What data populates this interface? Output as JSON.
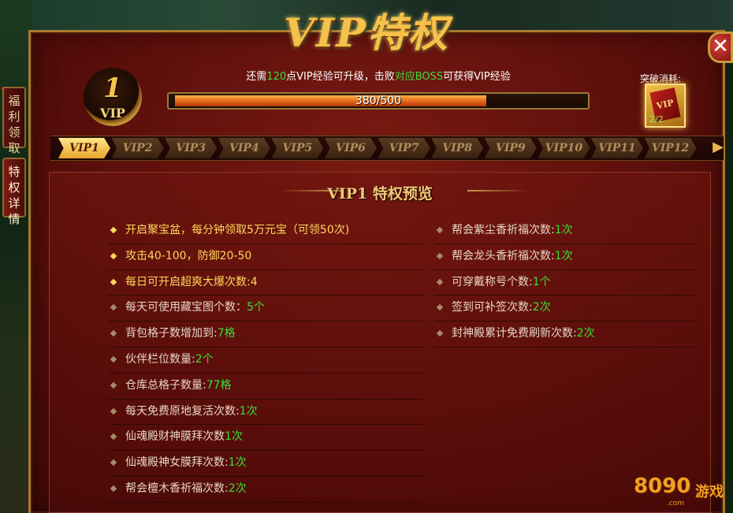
{
  "window": {
    "title": "VIP特权",
    "close_label": "✕"
  },
  "side_tabs": [
    {
      "label": "福利领取"
    },
    {
      "label": "特权详情"
    }
  ],
  "vip_badge": {
    "level": "1",
    "label": "VIP"
  },
  "notice": {
    "part1": "还需",
    "points": "120",
    "part2": "点VIP经验可升级，击败",
    "boss": "对应BOSS",
    "part3": "可获得VIP经验"
  },
  "progress": {
    "current": 380,
    "max": 500,
    "text": "380/500",
    "fraction": 0.76
  },
  "breakthrough": {
    "label": "突破消耗:",
    "item_text": "VIP",
    "count": "2/2"
  },
  "vip_tabs": [
    "VIP1",
    "VIP2",
    "VIP3",
    "VIP4",
    "VIP5",
    "VIP6",
    "VIP7",
    "VIP8",
    "VIP9",
    "VIP10",
    "VIP11",
    "VIP12"
  ],
  "active_tab": 0,
  "section": {
    "title": "VIP1 特权预览"
  },
  "privileges_left": [
    {
      "text": "开启聚宝盆，每分钟领取5万元宝（可领50次)",
      "value": "",
      "highlight": true
    },
    {
      "text": "攻击40-100，防御20-50",
      "value": "",
      "highlight": true
    },
    {
      "text": "每日可开启超爽大爆次数:4",
      "value": "",
      "highlight": true
    },
    {
      "text": "每天可使用藏宝图个数：",
      "value": "5个",
      "highlight": false
    },
    {
      "text": "背包格子数增加到:",
      "value": "7格",
      "highlight": false
    },
    {
      "text": "伙伴栏位数量:",
      "value": "2个",
      "highlight": false
    },
    {
      "text": "仓库总格子数量:",
      "value": "77格",
      "highlight": false
    },
    {
      "text": "每天免费原地复活次数:",
      "value": "1次",
      "highlight": false
    },
    {
      "text": "仙魂殿财神膜拜次数",
      "value": "1次",
      "highlight": false
    },
    {
      "text": "仙魂殿神女膜拜次数:",
      "value": "1次",
      "highlight": false
    },
    {
      "text": "帮会檀木香祈福次数:",
      "value": "2次",
      "highlight": false
    }
  ],
  "privileges_right": [
    {
      "text": "帮会紫尘香祈福次数:",
      "value": "1次"
    },
    {
      "text": "帮会龙头香祈福次数:",
      "value": "1次"
    },
    {
      "text": "可穿戴称号个数:",
      "value": "1个"
    },
    {
      "text": "签到可补签次数:",
      "value": "2次"
    },
    {
      "text": "封神殿累计免费刷新次数:",
      "value": "2次"
    }
  ],
  "logo": {
    "digits": "8090",
    "word": "游戏",
    "domain": ".com"
  },
  "colors": {
    "accent_gold": "#f4c24a",
    "value_green": "#3adf3a",
    "panel_red": "#5c0f0b"
  }
}
